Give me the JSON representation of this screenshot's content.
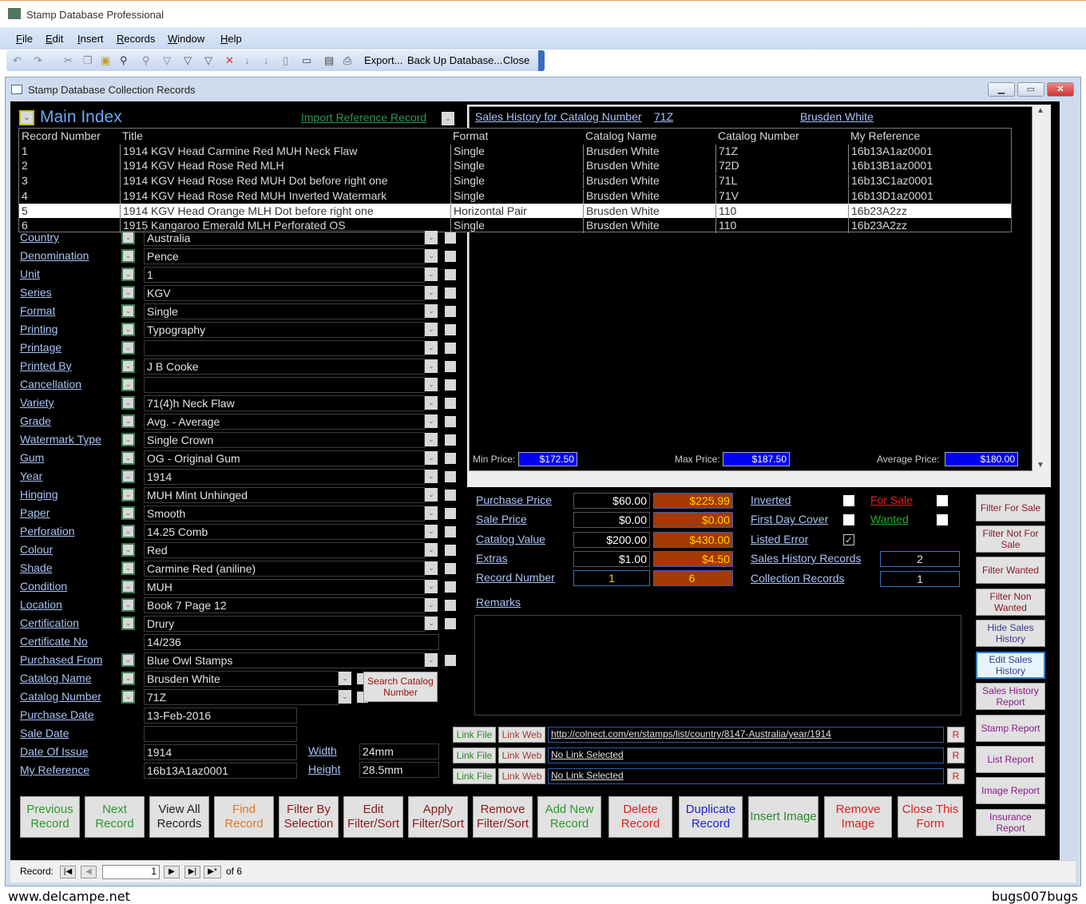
{
  "app": {
    "title": "Stamp Database Professional"
  },
  "menu": [
    "File",
    "Edit",
    "Insert",
    "Records",
    "Window",
    "Help"
  ],
  "toolbar": {
    "export": "Export...",
    "backup": "Back Up Database...",
    "close": "Close"
  },
  "window": {
    "title": "Stamp Database Collection Records"
  },
  "main_index": {
    "title": "Main Index",
    "import_link": "Import Reference Record",
    "columns": [
      "Record Number",
      "Title",
      "Format",
      "Catalog Name",
      "Catalog Number",
      "My Reference"
    ],
    "rows": [
      [
        "1",
        "1914 KGV Head Carmine Red  MUH Neck Flaw",
        "Single",
        "Brusden White",
        "71Z",
        "16b13A1az0001"
      ],
      [
        "2",
        "1914 KGV Head Rose Red  MLH",
        "Single",
        "Brusden White",
        "72D",
        "16b13B1az0001"
      ],
      [
        "3",
        "1914 KGV Head Rose Red  MUH Dot before right one",
        "Single",
        "Brusden White",
        "71L",
        "16b13C1az0001"
      ],
      [
        "4",
        "1914 KGV Head Rose Red  MUH Inverted Watermark",
        "Single",
        "Brusden White",
        "71V",
        "16b13D1az0001"
      ],
      [
        "5",
        "1914 KGV Head Orange MLH Dot before right one",
        "Horizontal Pair",
        "Brusden White",
        "110",
        "16b23A2zz"
      ],
      [
        "6",
        "1915 Kangaroo Emerald MLH Perforated OS",
        "Single",
        "Brusden White",
        "110",
        "16b23A2zz"
      ]
    ],
    "selected_row": 5
  },
  "sales_history": {
    "title": "Sales History for Catalog Number",
    "catalog_number": "71Z",
    "catalog_name": "Brusden White",
    "min_label": "Min Price:",
    "min": "$172.50",
    "max_label": "Max Price:",
    "max": "$187.50",
    "avg_label": "Average Price:",
    "avg": "$180.00"
  },
  "fields": [
    {
      "label": "Country",
      "value": "Australia",
      "dd": true
    },
    {
      "label": "Denomination",
      "value": "Pence",
      "dd": true
    },
    {
      "label": "Unit",
      "value": "1",
      "dd": true
    },
    {
      "label": "Series",
      "value": "KGV",
      "dd": true
    },
    {
      "label": "Format",
      "value": "Single",
      "dd": true
    },
    {
      "label": "Printing",
      "value": "Typography",
      "dd": true
    },
    {
      "label": "Printage",
      "value": "",
      "dd": true
    },
    {
      "label": "Printed By",
      "value": "J B Cooke",
      "dd": true
    },
    {
      "label": "Cancellation",
      "value": "",
      "dd": true
    },
    {
      "label": "Variety",
      "value": "71(4)h Neck Flaw",
      "dd": true
    },
    {
      "label": "Grade",
      "value": "Avg. - Average",
      "dd": true
    },
    {
      "label": "Watermark Type",
      "value": "Single Crown",
      "dd": true
    },
    {
      "label": "Gum",
      "value": "OG - Original Gum",
      "dd": true
    },
    {
      "label": "Year",
      "value": "1914",
      "dd": true
    },
    {
      "label": "Hinging",
      "value": "MUH  Mint Unhinged",
      "dd": true
    },
    {
      "label": "Paper",
      "value": "Smooth",
      "dd": true
    },
    {
      "label": "Perforation",
      "value": "14.25 Comb",
      "dd": true
    },
    {
      "label": "Colour",
      "value": "Red",
      "dd": true
    },
    {
      "label": "Shade",
      "value": "Carmine Red (aniline)",
      "dd": true
    },
    {
      "label": "Condition",
      "value": "MUH",
      "dd": true
    },
    {
      "label": "Location",
      "value": "Book 7 Page 12",
      "dd": true
    },
    {
      "label": "Certification",
      "value": "Drury",
      "dd": true
    },
    {
      "label": "Certificate No",
      "value": "14/236",
      "dd": false
    },
    {
      "label": "Purchased From",
      "value": "Blue Owl Stamps",
      "dd": true
    },
    {
      "label": "Catalog Name",
      "value": "Brusden White",
      "dd": true,
      "short": true
    },
    {
      "label": "Catalog Number",
      "value": "71Z",
      "dd": true,
      "short": true
    },
    {
      "label": "Purchase Date",
      "value": "13-Feb-2016",
      "dd": false,
      "date": true
    },
    {
      "label": "Sale Date",
      "value": "",
      "dd": false,
      "date": true
    },
    {
      "label": "Date Of Issue",
      "value": "1914",
      "dd": false,
      "date": true
    },
    {
      "label": "My Reference",
      "value": "16b13A1az0001",
      "dd": false,
      "date": true
    }
  ],
  "dimensions": {
    "width_label": "Width",
    "width": "24mm",
    "height_label": "Height",
    "height": "28.5mm"
  },
  "search_catalog_button": "Search Catalog Number",
  "prices": [
    {
      "label": "Purchase Price",
      "value": "$60.00",
      "total": "$225.99"
    },
    {
      "label": "Sale Price",
      "value": "$0.00",
      "total": "$0.00"
    },
    {
      "label": "Catalog Value",
      "value": "$200.00",
      "total": "$430.00"
    },
    {
      "label": "Extras",
      "value": "$1.00",
      "total": "$4.50"
    },
    {
      "label": "Record Number",
      "value": "1",
      "total": "6"
    }
  ],
  "flags": [
    {
      "label": "Inverted",
      "checked": false
    },
    {
      "label": "First Day Cover",
      "checked": false
    },
    {
      "label": "Listed Error",
      "checked": true
    }
  ],
  "for_sale": {
    "label": "For Sale",
    "checked": false,
    "color": "#e02020"
  },
  "wanted": {
    "label": "Wanted",
    "checked": false,
    "color": "#20b020"
  },
  "counts": [
    {
      "label": "Sales History Records",
      "value": "2"
    },
    {
      "label": "Collection Records",
      "value": "1"
    }
  ],
  "remarks": {
    "label": "Remarks",
    "value": ""
  },
  "links": [
    {
      "file": "Link File",
      "web": "Link Web",
      "url": "http://colnect.com/en/stamps/list/country/8147-Australia/year/1914",
      "r": "R"
    },
    {
      "file": "Link File",
      "web": "Link Web",
      "url": "No Link Selected",
      "r": "R"
    },
    {
      "file": "Link File",
      "web": "Link Web",
      "url": "No Link Selected",
      "r": "R"
    }
  ],
  "bottom_buttons": [
    {
      "label": "Previous Record",
      "color": "#2a9a2a"
    },
    {
      "label": "Next Record",
      "color": "#2a9a2a"
    },
    {
      "label": "View All Records",
      "color": "#222"
    },
    {
      "label": "Find Record",
      "color": "#e07820"
    },
    {
      "label": "Filter By Selection",
      "color": "#8a1a1a"
    },
    {
      "label": "Edit Filter/Sort",
      "color": "#8a1a1a"
    },
    {
      "label": "Apply Filter/Sort",
      "color": "#8a1a1a"
    },
    {
      "label": "Remove Filter/Sort",
      "color": "#8a1a1a"
    },
    {
      "label": "Add New Record",
      "color": "#2a9a2a"
    },
    {
      "label": "Delete Record",
      "color": "#e02020"
    },
    {
      "label": "Duplicate Record",
      "color": "#2020d0"
    },
    {
      "label": "Insert Image",
      "color": "#2a8a2a"
    },
    {
      "label": "Remove Image",
      "color": "#e02020"
    },
    {
      "label": "Close This Form",
      "color": "#e02020"
    }
  ],
  "right_buttons": [
    {
      "label": "Filter For Sale",
      "color": "#8a1a2a"
    },
    {
      "label": "Filter Not For Sale",
      "color": "#8a1a2a"
    },
    {
      "label": "Filter Wanted",
      "color": "#8a1a2a"
    },
    {
      "label": "Filter Non Wanted",
      "color": "#8a1a2a"
    },
    {
      "label": "Hide Sales History",
      "color": "#3a3a8a"
    },
    {
      "label": "Edit Sales History",
      "color": "#3a3a8a",
      "focused": true
    },
    {
      "label": "Sales History Report",
      "color": "#8a1a8a"
    },
    {
      "label": "Stamp Report",
      "color": "#8a1a8a"
    },
    {
      "label": "List Report",
      "color": "#8a1a8a"
    },
    {
      "label": "Image Report",
      "color": "#8a1a8a"
    },
    {
      "label": "Insurance Report",
      "color": "#8a1a8a"
    }
  ],
  "record_nav": {
    "label": "Record:",
    "current": "1",
    "of": "of 6"
  },
  "footer": {
    "left": "www.delcampe.net",
    "right": "bugs007bugs"
  }
}
